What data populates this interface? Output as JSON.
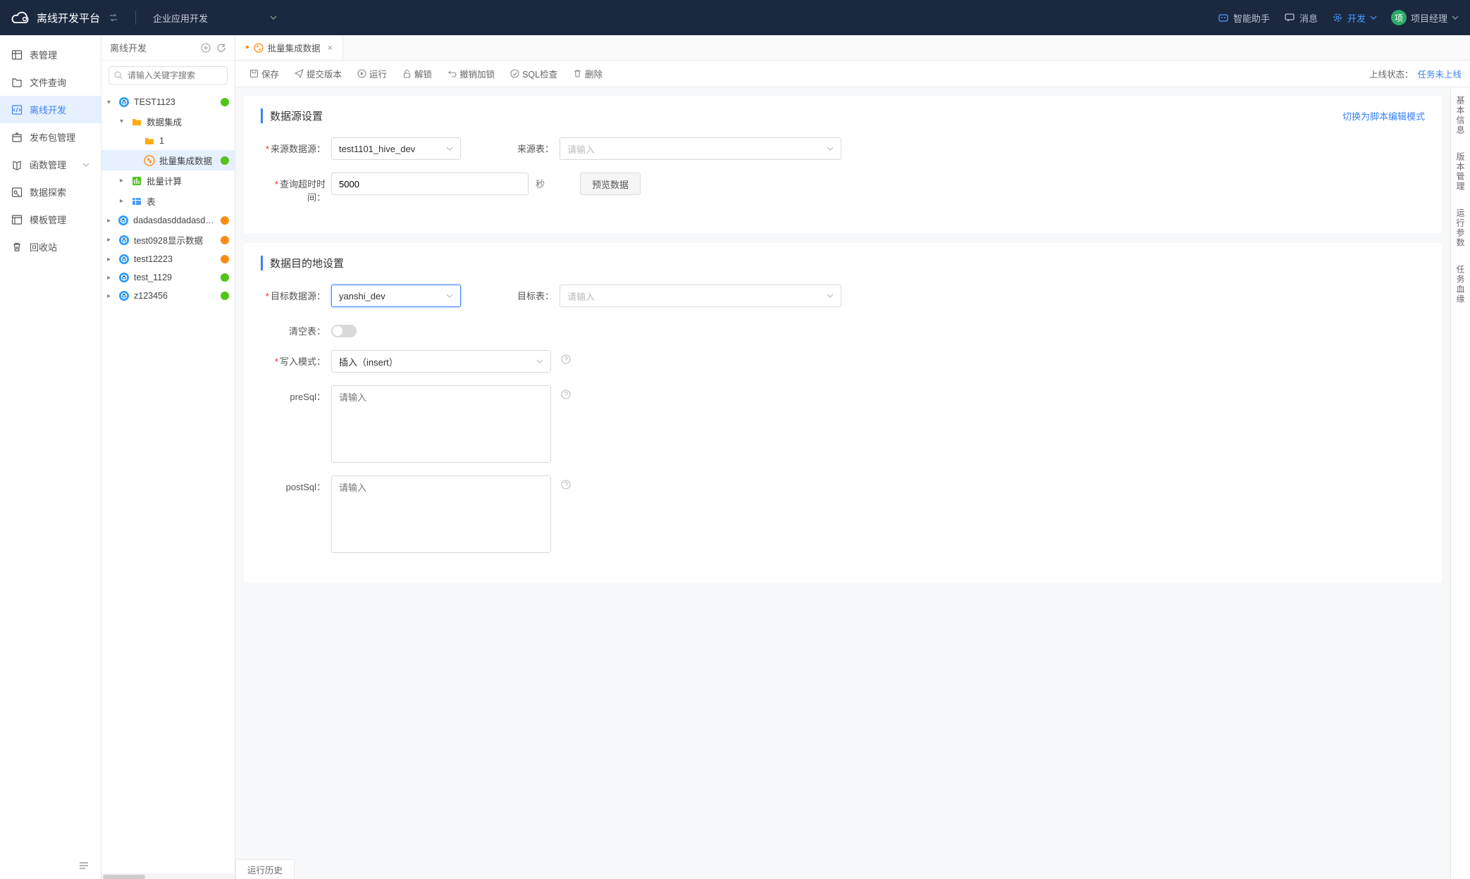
{
  "header": {
    "platform_name": "离线开发平台",
    "project_selector": "企业应用开发",
    "assistant": "智能助手",
    "messages": "消息",
    "dev_mode": "开发",
    "role": "项目经理",
    "avatar_initial": "项"
  },
  "nav": {
    "items": [
      {
        "label": "表管理",
        "icon": "table"
      },
      {
        "label": "文件查询",
        "icon": "folder"
      },
      {
        "label": "离线开发",
        "icon": "code",
        "active": true
      },
      {
        "label": "发布包管理",
        "icon": "package"
      },
      {
        "label": "函数管理",
        "icon": "function",
        "chevron": true
      },
      {
        "label": "数据探索",
        "icon": "explore"
      },
      {
        "label": "模板管理",
        "icon": "template"
      },
      {
        "label": "回收站",
        "icon": "trash"
      }
    ]
  },
  "tree": {
    "title": "离线开发",
    "search_placeholder": "请输入关键字搜索",
    "nodes": [
      {
        "label": "TEST1123",
        "depth": 0,
        "icon": "cube-blue",
        "status": "ok",
        "expanded": true
      },
      {
        "label": "数据集成",
        "depth": 1,
        "icon": "folder-orange",
        "expanded": true
      },
      {
        "label": "1",
        "depth": 2,
        "icon": "folder-orange"
      },
      {
        "label": "批量集成数据",
        "depth": 2,
        "icon": "sync-orange",
        "status": "ok",
        "selected": true
      },
      {
        "label": "批量计算",
        "depth": 1,
        "icon": "calc-green",
        "collapsed": true
      },
      {
        "label": "表",
        "depth": 1,
        "icon": "table-blue",
        "collapsed": true
      },
      {
        "label": "dadasdasddadasdasdc",
        "depth": 0,
        "icon": "cube-blue",
        "status": "warn",
        "collapsed": true
      },
      {
        "label": "test0928显示数据",
        "depth": 0,
        "icon": "cube-blue",
        "status": "warn",
        "collapsed": true
      },
      {
        "label": "test12223",
        "depth": 0,
        "icon": "cube-blue",
        "status": "warn",
        "collapsed": true
      },
      {
        "label": "test_1129",
        "depth": 0,
        "icon": "cube-blue",
        "status": "ok",
        "collapsed": true
      },
      {
        "label": "z123456",
        "depth": 0,
        "icon": "cube-blue",
        "status": "ok",
        "collapsed": true
      }
    ]
  },
  "tab": {
    "label": "批量集成数据",
    "dirty": true
  },
  "toolbar": {
    "save": "保存",
    "submit": "提交版本",
    "run": "运行",
    "unlock": "解锁",
    "revoke_lock": "撤销加锁",
    "sql_check": "SQL检查",
    "delete": "删除",
    "status_label": "上线状态：",
    "status_value": "任务未上线"
  },
  "sections": {
    "source": {
      "title": "数据源设置",
      "script_mode_link": "切换为脚本编辑模式",
      "source_ds_label": "来源数据源：",
      "source_ds_value": "test1101_hive_dev",
      "source_table_label": "来源表：",
      "source_table_placeholder": "请输入",
      "timeout_label": "查询超时时间：",
      "timeout_value": "5000",
      "timeout_unit": "秒",
      "preview_btn": "预览数据"
    },
    "target": {
      "title": "数据目的地设置",
      "target_ds_label": "目标数据源：",
      "target_ds_value": "yanshi_dev",
      "target_table_label": "目标表：",
      "target_table_placeholder": "请输入",
      "truncate_label": "清空表：",
      "write_mode_label": "写入模式：",
      "write_mode_value": "插入（insert）",
      "presql_label": "preSql：",
      "presql_placeholder": "请输入",
      "postsql_label": "postSql：",
      "postsql_placeholder": "请输入"
    }
  },
  "right_tabs": [
    "基本信息",
    "版本管理",
    "运行参数",
    "任务血缘"
  ],
  "footer_tab": "运行历史"
}
